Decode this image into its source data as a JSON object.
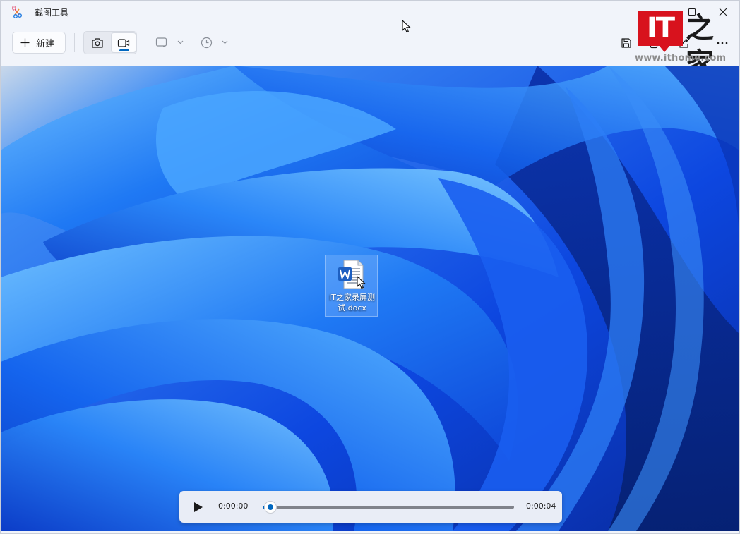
{
  "window": {
    "title": "截图工具",
    "app_icon": "snipping-tool-icon",
    "controls": [
      "minimize-icon",
      "maximize-icon",
      "close-icon"
    ]
  },
  "toolbar": {
    "new_label": "新建",
    "modes": [
      {
        "name": "photo-mode",
        "icon": "camera-icon",
        "selected": false
      },
      {
        "name": "video-mode",
        "icon": "video-camera-icon",
        "selected": true
      }
    ],
    "shape_dropdown_icon": "rectangle-snip-icon",
    "delay_dropdown_icon": "clock-icon",
    "right_icons": [
      "save-icon",
      "copy-icon",
      "share-icon",
      "more-icon"
    ]
  },
  "watermark": {
    "logo_text": "IT",
    "logo_cn": "之家",
    "url": "www.ithome.com"
  },
  "desktop": {
    "file_icon": "word-document-icon",
    "file_name_line1": "IT之家录屏测",
    "file_name_line2": "试.docx"
  },
  "player": {
    "current_time": "0:00:00",
    "end_time": "0:00:04",
    "progress": 0.03,
    "accent": "#0067c0"
  }
}
